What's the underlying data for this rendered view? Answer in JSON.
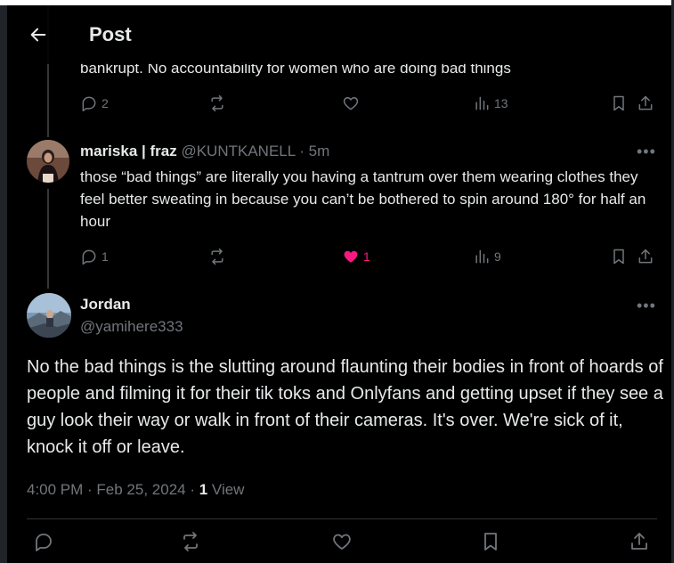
{
  "header": {
    "title": "Post"
  },
  "parent_post": {
    "partial_text": "bankrupt. No accountability for women who are doing bad things",
    "replies": "2",
    "likes": "",
    "views": "13"
  },
  "reply": {
    "name": "mariska | fraz",
    "handle": "@KUNTKANELL",
    "time": "· 5m",
    "text": "those “bad things” are literally you having a tantrum over them wearing clothes they feel better sweating in because you can’t be bothered to spin around 180° for half an hour",
    "replies": "1",
    "likes": "1",
    "views": "9"
  },
  "main_post": {
    "name": "Jordan",
    "handle": "@yamihere333",
    "text": "No the bad things is the slutting around flaunting their bodies in front of hoards of people and filming it for their tik toks and Onlyfans and getting upset if they see a guy look their way or walk in front of their cameras. It's over. We're sick of it, knock it off or leave.",
    "timestamp": "4:00 PM · Feb 25, 2024 · ",
    "view_count": "1",
    "view_label": " View"
  },
  "colors": {
    "like_active": "#f91880",
    "muted": "#71767b",
    "text": "#e7e9ea",
    "bg": "#000000"
  },
  "icons": [
    "back-arrow-icon",
    "reply-icon",
    "repost-icon",
    "like-icon",
    "views-icon",
    "bookmark-icon",
    "share-icon",
    "more-icon"
  ]
}
